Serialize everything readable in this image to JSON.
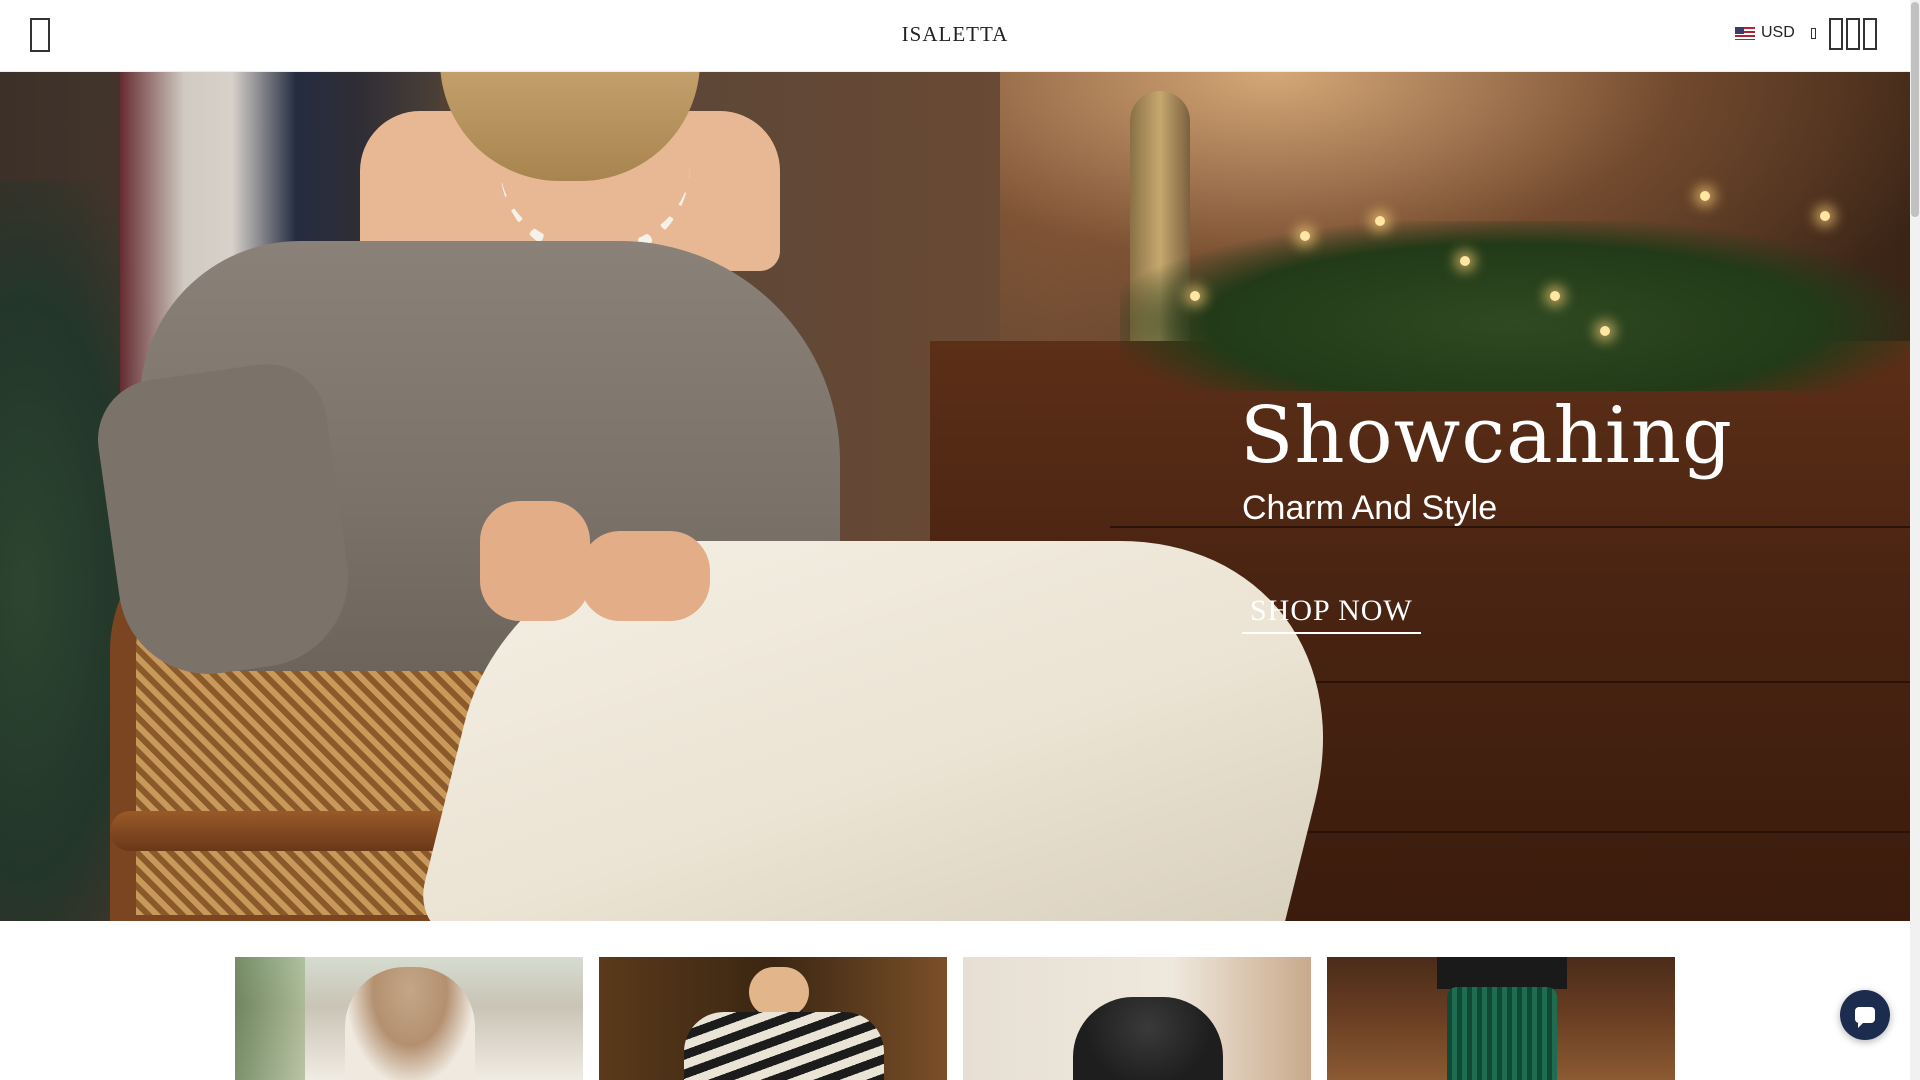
{
  "header": {
    "logo_text": "ISALETTA",
    "currency": {
      "code": "USD",
      "flag_icon": "us-flag-icon"
    }
  },
  "hero": {
    "title": "Showcahing",
    "subtitle": "Charm And Style",
    "cta_label": "SHOP NOW"
  },
  "colors": {
    "header_bg": "#ffffff",
    "hero_text": "#ffffff",
    "chat_button": "#1b2c4f"
  }
}
